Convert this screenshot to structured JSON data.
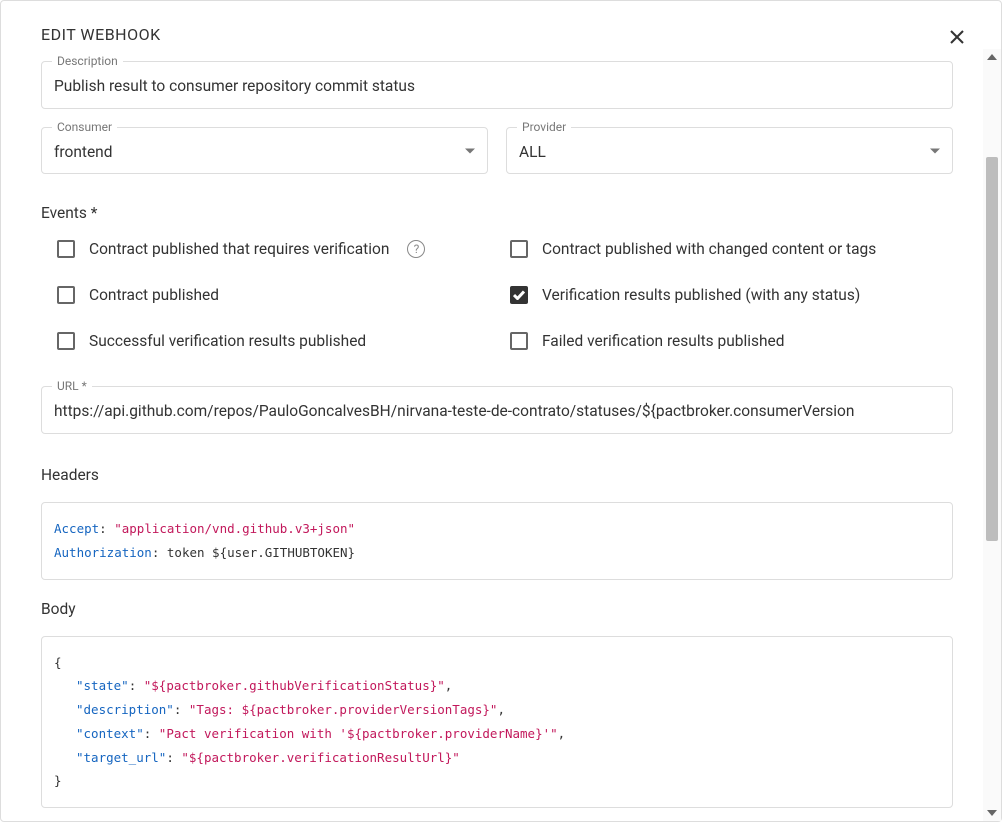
{
  "modal": {
    "title": "EDIT WEBHOOK"
  },
  "description": {
    "label": "Description",
    "value": "Publish result to consumer repository commit status"
  },
  "consumer": {
    "label": "Consumer",
    "value": "frontend"
  },
  "provider": {
    "label": "Provider",
    "value": "ALL"
  },
  "events": {
    "label": "Events *",
    "items": [
      {
        "label": "Contract published that requires verification",
        "checked": false,
        "help": true
      },
      {
        "label": "Contract published with changed content or tags",
        "checked": false
      },
      {
        "label": "Contract published",
        "checked": false
      },
      {
        "label": "Verification results published (with any status)",
        "checked": true
      },
      {
        "label": "Successful verification results published",
        "checked": false
      },
      {
        "label": "Failed verification results published",
        "checked": false
      }
    ]
  },
  "url": {
    "label": "URL *",
    "value": "https://api.github.com/repos/PauloGoncalvesBH/nirvana-teste-de-contrato/statuses/${pactbroker.consumerVersion"
  },
  "headers": {
    "label": "Headers",
    "lines": [
      {
        "key": "Accept",
        "type": "string",
        "value": "\"application/vnd.github.v3+json\""
      },
      {
        "key": "Authorization",
        "type": "plain",
        "value": "token ${user.GITHUBTOKEN}"
      }
    ]
  },
  "body": {
    "label": "Body",
    "entries": [
      {
        "key": "\"state\"",
        "value": "\"${pactbroker.githubVerificationStatus}\""
      },
      {
        "key": "\"description\"",
        "value": "\"Tags: ${pactbroker.providerVersionTags}\""
      },
      {
        "key": "\"context\"",
        "value": "\"Pact verification with '${pactbroker.providerName}'\""
      },
      {
        "key": "\"target_url\"",
        "value": "\"${pactbroker.verificationResultUrl}\""
      }
    ]
  }
}
